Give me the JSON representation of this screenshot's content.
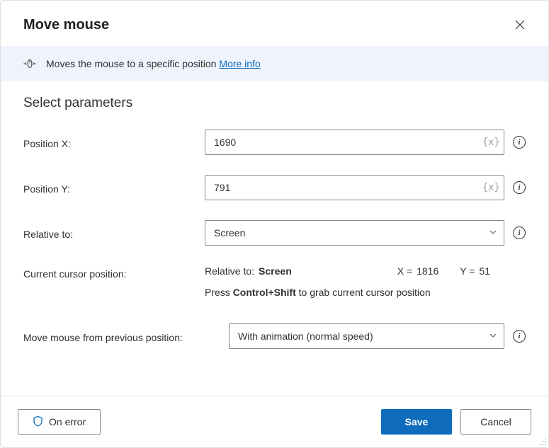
{
  "header": {
    "title": "Move mouse"
  },
  "banner": {
    "text": "Moves the mouse to a specific position",
    "more_info": "More info"
  },
  "section_heading": "Select parameters",
  "fields": {
    "posx": {
      "label": "Position X:",
      "value": "1690"
    },
    "posy": {
      "label": "Position Y:",
      "value": "791"
    },
    "relative": {
      "label": "Relative to:",
      "selected": "Screen"
    },
    "cursor": {
      "label": "Current cursor position:",
      "rel_label": "Relative to:",
      "rel_value": "Screen",
      "x_label": "X =",
      "x_value": "1816",
      "y_label": "Y =",
      "y_value": "51",
      "hint_prefix": "Press ",
      "hint_keys": "Control+Shift",
      "hint_suffix": " to grab current cursor position"
    },
    "move_mode": {
      "label": "Move mouse from previous position:",
      "selected": "With animation (normal speed)"
    }
  },
  "footer": {
    "on_error": "On error",
    "save": "Save",
    "cancel": "Cancel"
  },
  "info_tip": "i",
  "var_hint": "{x}"
}
